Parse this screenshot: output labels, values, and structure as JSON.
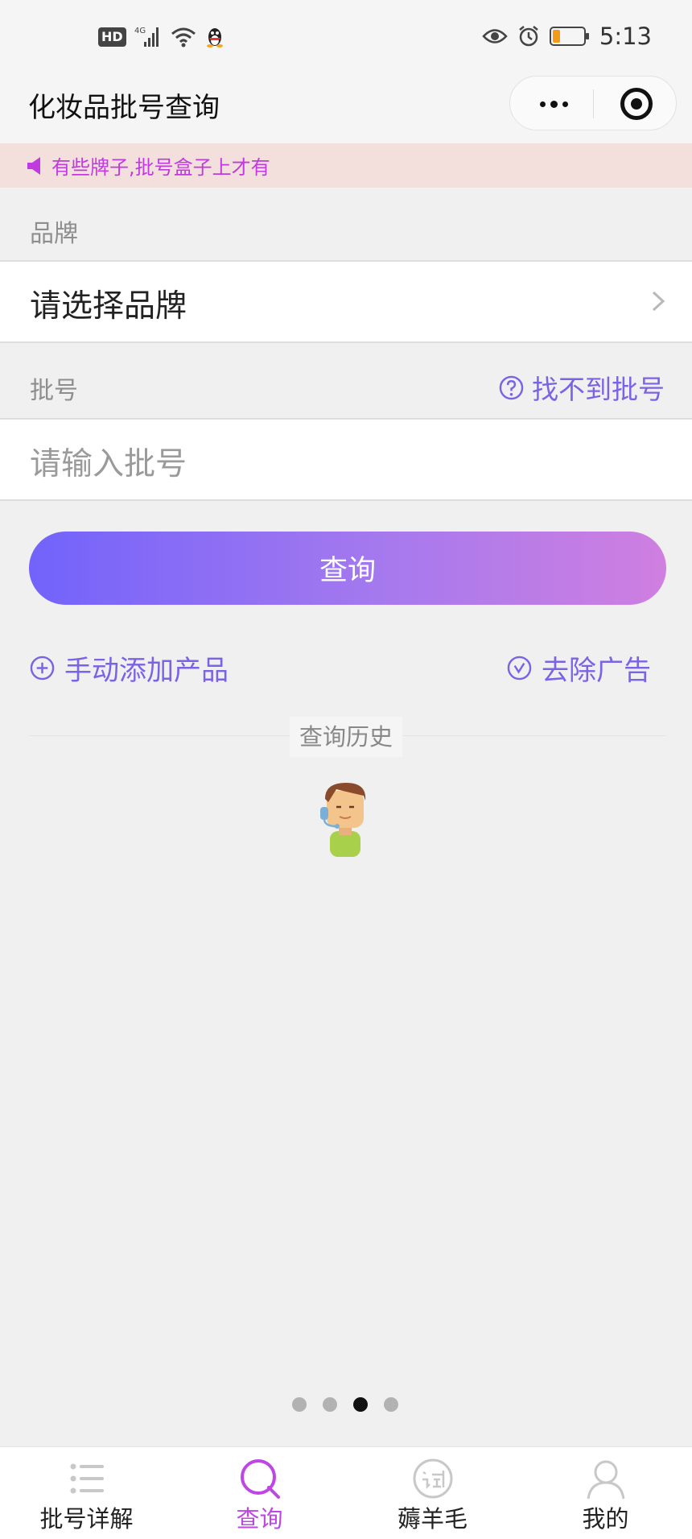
{
  "status_bar": {
    "hd_label": "HD",
    "network": "4G",
    "time": "5:13",
    "icons": [
      "hd-icon",
      "signal-icon",
      "wifi-icon",
      "qq-icon",
      "eye-icon",
      "alarm-icon",
      "battery-icon"
    ]
  },
  "nav": {
    "title": "化妆品批号查询",
    "more_icon": "more-dots-icon",
    "close_icon": "target-icon"
  },
  "notice": {
    "text": "有些牌子,批号盒子上才有",
    "icon": "speaker-icon",
    "color": "#c03ae0",
    "background": "#f3dfdb"
  },
  "form": {
    "brand_label": "品牌",
    "brand_value": "请选择品牌",
    "batch_label": "批号",
    "batch_placeholder": "请输入批号",
    "help_link": "找不到批号"
  },
  "query_button": "查询",
  "actions": {
    "add_product": "手动添加产品",
    "remove_ads": "去除广告"
  },
  "history": {
    "title": "查询历史"
  },
  "pager": {
    "count": 4,
    "active_index": 2
  },
  "tabbar": {
    "items": [
      {
        "label": "批号详解",
        "icon": "list-icon",
        "active": false
      },
      {
        "label": "查询",
        "icon": "search-icon",
        "active": true
      },
      {
        "label": "薅羊毛",
        "icon": "trial-icon",
        "active": false
      },
      {
        "label": "我的",
        "icon": "user-icon",
        "active": false
      }
    ]
  },
  "colors": {
    "accent": "#7b63e6",
    "active_tab": "#bf45e4",
    "button_gradient": [
      "#7263fb",
      "#cf7fe0"
    ]
  }
}
